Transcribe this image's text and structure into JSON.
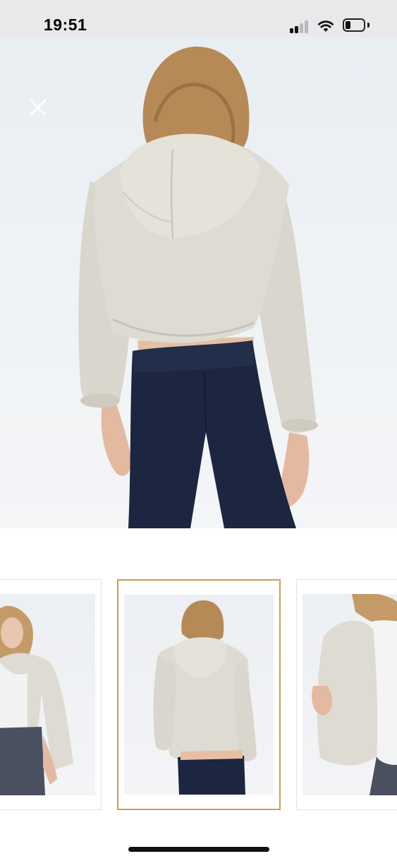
{
  "status_bar": {
    "time": "19:51",
    "signal_icon": "cellular-signal-icon",
    "wifi_icon": "wifi-icon",
    "battery_icon": "battery-icon",
    "battery_level": 0.3
  },
  "viewer": {
    "close_icon": "close-icon",
    "main_image": "product-photo-back-view",
    "selected_thumbnail": 1
  },
  "thumbnails": [
    {
      "image": "product-photo-front-view",
      "selected": false
    },
    {
      "image": "product-photo-back-view",
      "selected": true
    },
    {
      "image": "product-photo-side-detail",
      "selected": false
    }
  ],
  "colors": {
    "selected_border": "#d39a52",
    "jacket": "#dedbd2",
    "trousers": "#1c2640",
    "hair": "#b68a57"
  }
}
